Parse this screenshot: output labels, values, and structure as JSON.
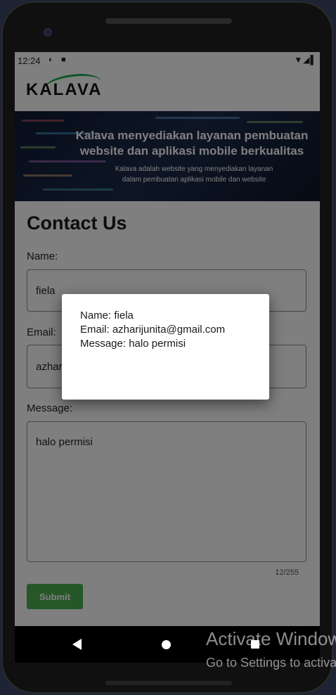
{
  "status_bar": {
    "time": "12:24",
    "icons": [
      "sync-icon",
      "sd-card-icon"
    ],
    "right_icons": [
      "wifi-icon",
      "signal-icon",
      "battery-icon"
    ]
  },
  "header": {
    "logo_text": "KALAVA"
  },
  "hero": {
    "title": "Kalava menyediakan layanan pembuatan website dan aplikasi mobile berkualitas",
    "subtitle": "Kalava adalah website yang menyediakan layanan dalam pembuatan aplikasi mobile dan website"
  },
  "form": {
    "title": "Contact Us",
    "name_label": "Name:",
    "name_value": "fiela",
    "email_label": "Email:",
    "email_value": "azharijunita@gmail.com",
    "message_label": "Message:",
    "message_value": "halo permisi",
    "counter": "12/255",
    "submit_label": "Submit"
  },
  "dialog": {
    "line1": "Name: fiela",
    "line2": "Email: azharijunita@gmail.com",
    "line3": "Message: halo permisi"
  },
  "nav": {
    "buttons": [
      "back-icon",
      "home-icon",
      "recents-icon"
    ]
  },
  "watermark": {
    "title": "Activate Windows",
    "subtitle": "Go to Settings to activate Windows."
  }
}
